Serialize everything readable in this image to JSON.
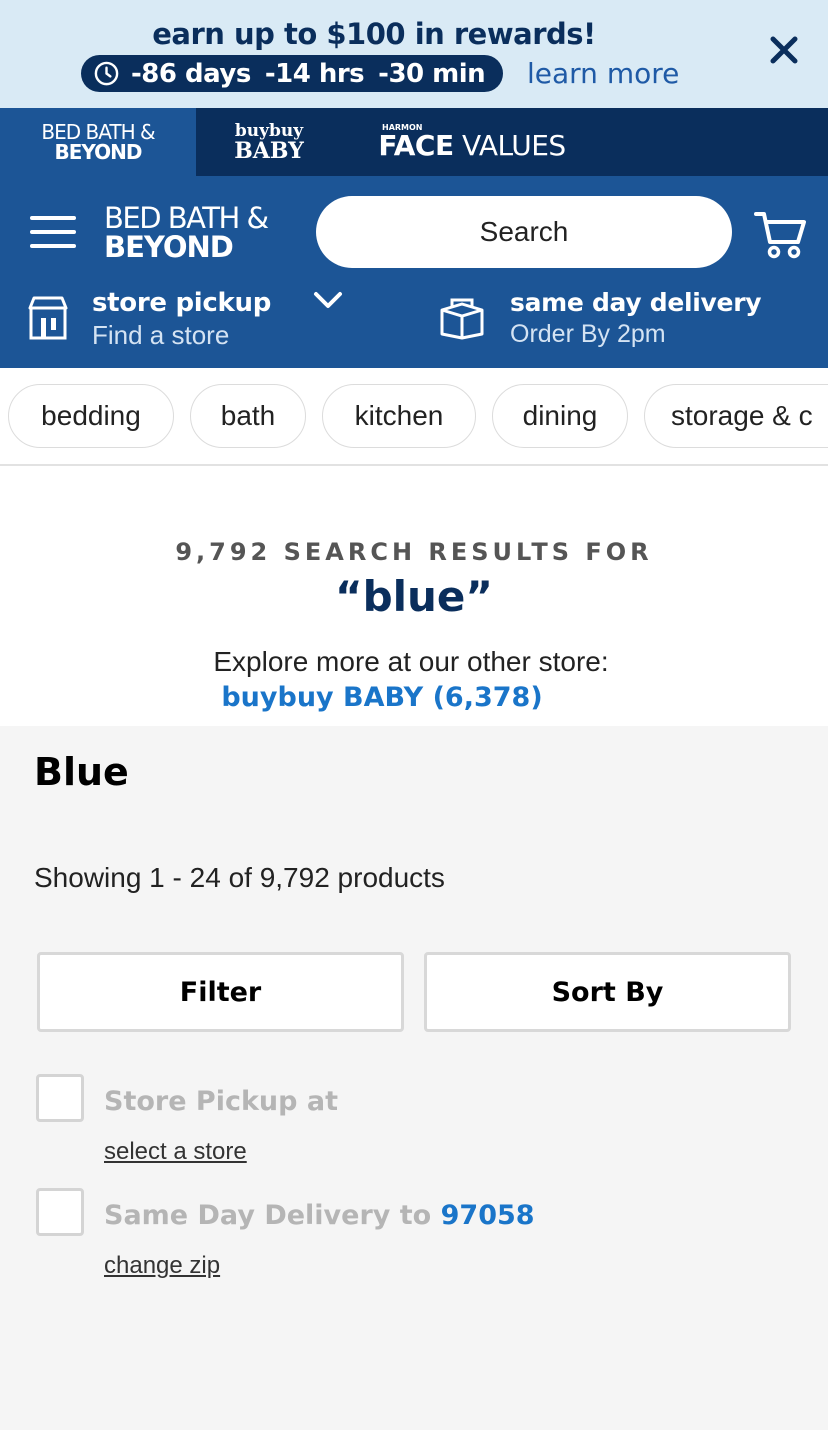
{
  "promo": {
    "title": "earn up to $100 in rewards!",
    "countdown": {
      "days": "-86 days",
      "hours": "-14 hrs",
      "minutes": "-30 min"
    },
    "learn_more": "learn more"
  },
  "brands": {
    "bbb": {
      "line1": "BED BATH &",
      "line2": "BEYOND"
    },
    "baby": {
      "line1": "buybuy",
      "line2": "BABY"
    },
    "face": {
      "small": "HARMON",
      "bold": "FACE",
      "rest": " VALUES"
    }
  },
  "header": {
    "logo_line1": "BED BATH &",
    "logo_line2": "BEYOND",
    "search_placeholder": "Search",
    "pickup_title": "store pickup",
    "pickup_sub": "Find a store",
    "delivery_title": "same day delivery",
    "delivery_sub": "Order By 2pm"
  },
  "categories": [
    "bedding",
    "bath",
    "kitchen",
    "dining",
    "storage & c"
  ],
  "results": {
    "count_text": "9,792 SEARCH RESULTS FOR",
    "query": "“blue”",
    "explore_text": "Explore more at our other store:",
    "baby_link": "buybuy BABY (6,378)"
  },
  "listing": {
    "title": "Blue",
    "showing": "Showing 1 - 24 of 9,792 products",
    "filter_label": "Filter",
    "sort_label": "Sort By",
    "store_pickup_label": "Store Pickup at",
    "select_store_link": "select a store",
    "same_day_label": "Same Day Delivery to ",
    "zip": "97058",
    "change_zip_link": "change zip"
  },
  "colors": {
    "navy": "#0a2e5c",
    "header_blue": "#1c5596",
    "promo_bg": "#d9eaf5",
    "link_blue": "#1a75c9"
  },
  "icons": [
    "clock-icon",
    "close-icon",
    "hamburger-icon",
    "cart-icon",
    "store-icon",
    "chevron-down-icon",
    "delivery-box-icon"
  ]
}
